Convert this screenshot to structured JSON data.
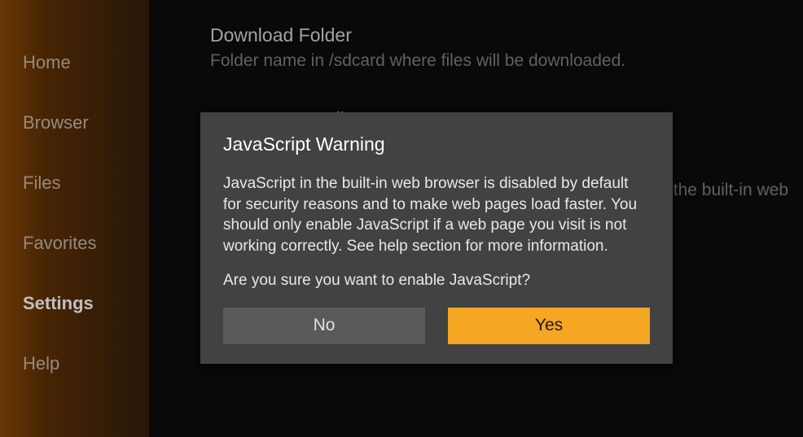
{
  "sidebar": {
    "items": [
      {
        "label": "Home",
        "active": false
      },
      {
        "label": "Browser",
        "active": false
      },
      {
        "label": "Files",
        "active": false
      },
      {
        "label": "Favorites",
        "active": false
      },
      {
        "label": "Settings",
        "active": true
      },
      {
        "label": "Help",
        "active": false
      }
    ]
  },
  "content": {
    "download_folder": {
      "title": "Download Folder",
      "desc": "Folder name in /sdcard where files will be downloaded."
    },
    "apk_auto": {
      "title": "APK Auto Install"
    },
    "js": {
      "desc_fragment": "the built-in web"
    }
  },
  "dialog": {
    "title": "JavaScript Warning",
    "body": "JavaScript in the built-in web browser is disabled by default for security reasons and to make web pages load faster. You should only enable JavaScript if a web page you visit is not working correctly. See help section for more information.",
    "confirm": "Are you sure you want to enable JavaScript?",
    "no_label": "No",
    "yes_label": "Yes"
  }
}
